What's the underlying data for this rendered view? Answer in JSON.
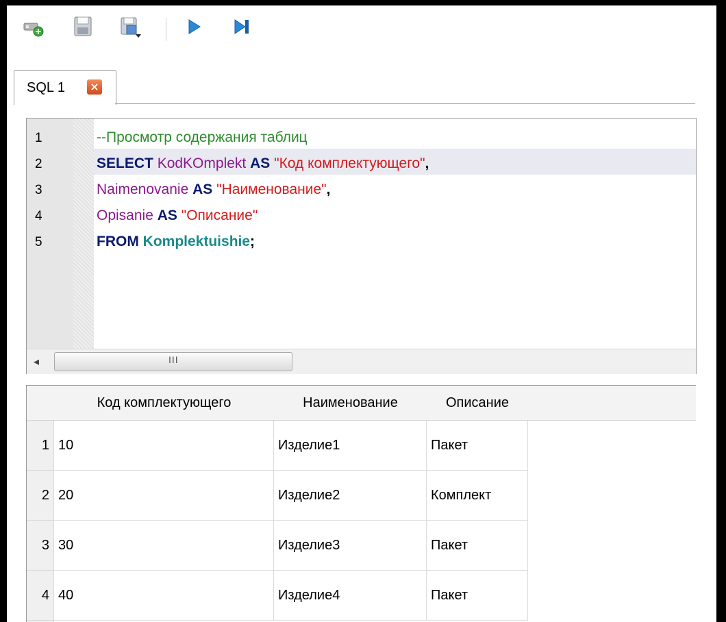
{
  "toolbar": {
    "buttons": [
      {
        "name": "new-connection-icon"
      },
      {
        "name": "save-icon"
      },
      {
        "name": "save-as-icon"
      },
      {
        "name": "execute-icon"
      },
      {
        "name": "execute-step-icon"
      }
    ]
  },
  "tabs": [
    {
      "label": "SQL 1",
      "close_glyph": "×"
    }
  ],
  "editor": {
    "line_numbers": [
      "1",
      "2",
      "3",
      "4",
      "5"
    ],
    "lines": [
      [
        {
          "cls": "cm",
          "text": "--Просмотр содержания таблиц"
        }
      ],
      [
        {
          "cls": "kw",
          "text": "SELECT"
        },
        {
          "cls": "",
          "text": " "
        },
        {
          "cls": "id",
          "text": "KodKOmplekt"
        },
        {
          "cls": "",
          "text": " "
        },
        {
          "cls": "kw",
          "text": "AS"
        },
        {
          "cls": "",
          "text": " "
        },
        {
          "cls": "st",
          "text": "\"Код комплектующего\""
        },
        {
          "cls": "pn",
          "text": ","
        }
      ],
      [
        {
          "cls": "id",
          "text": "Naimenovanie"
        },
        {
          "cls": "",
          "text": " "
        },
        {
          "cls": "kw",
          "text": "AS"
        },
        {
          "cls": "",
          "text": " "
        },
        {
          "cls": "st",
          "text": "\"Наименование\""
        },
        {
          "cls": "pn",
          "text": ","
        }
      ],
      [
        {
          "cls": "id",
          "text": "Opisanie"
        },
        {
          "cls": "",
          "text": " "
        },
        {
          "cls": "kw",
          "text": "AS"
        },
        {
          "cls": "",
          "text": " "
        },
        {
          "cls": "st",
          "text": "\"Описание\""
        }
      ],
      [
        {
          "cls": "kw",
          "text": "FROM"
        },
        {
          "cls": "",
          "text": " "
        },
        {
          "cls": "tbl",
          "text": "Komplektuishie"
        },
        {
          "cls": "pn",
          "text": ";"
        }
      ]
    ],
    "scroll_left_glyph": "◂",
    "scroll_grip": "III"
  },
  "results": {
    "columns": [
      "Код комплектующего",
      "Наименование",
      "Описание"
    ],
    "rows": [
      {
        "num": "1",
        "cells": [
          "10",
          "Изделие1",
          "Пакет"
        ]
      },
      {
        "num": "2",
        "cells": [
          "20",
          "Изделие2",
          "Комплект"
        ]
      },
      {
        "num": "3",
        "cells": [
          "30",
          "Изделие3",
          "Пакет"
        ]
      },
      {
        "num": "4",
        "cells": [
          "40",
          "Изделие4",
          "Пакет"
        ]
      }
    ]
  },
  "colors": {
    "keyword": "#0a1a6e",
    "comment": "#2e8b2e",
    "identifier": "#8b1a8b",
    "string": "#d41a1a",
    "table": "#1a8a8a",
    "execute": "#2a8ad8"
  }
}
